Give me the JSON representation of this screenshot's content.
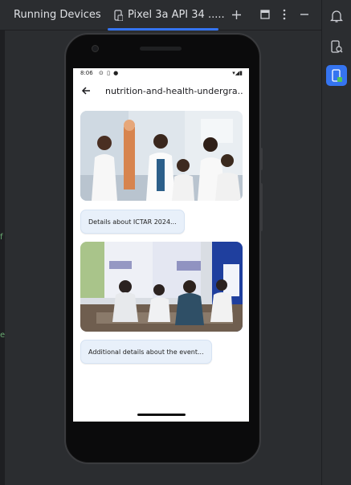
{
  "ide": {
    "tool_window_title": "Running Devices",
    "device_tab_label": "Pixel 3a API 34 .....",
    "add_icon": "plus-icon",
    "layout_icon": "window-layout-icon",
    "more_icon": "more-vertical-icon",
    "minimize_icon": "minimize-icon"
  },
  "right_strip": {
    "items": [
      {
        "icon": "notifications-bell-icon"
      },
      {
        "icon": "device-explorer-icon"
      },
      {
        "icon": "running-devices-icon"
      }
    ],
    "accent": "#3574f0"
  },
  "device": {
    "status_time": "8:06",
    "status_icons": "⊙ ▯ ●",
    "status_right": "▾◢▮",
    "app_title": "nutrition-and-health-undergra...",
    "cards": [
      {
        "type": "image",
        "image": "students-lab-coats-anatomy-model"
      },
      {
        "type": "text",
        "label": "Details about ICTAR 2024..."
      },
      {
        "type": "image",
        "image": "people-at-event-registration-desk"
      },
      {
        "type": "text",
        "label": "Additional details about the event..."
      }
    ]
  }
}
